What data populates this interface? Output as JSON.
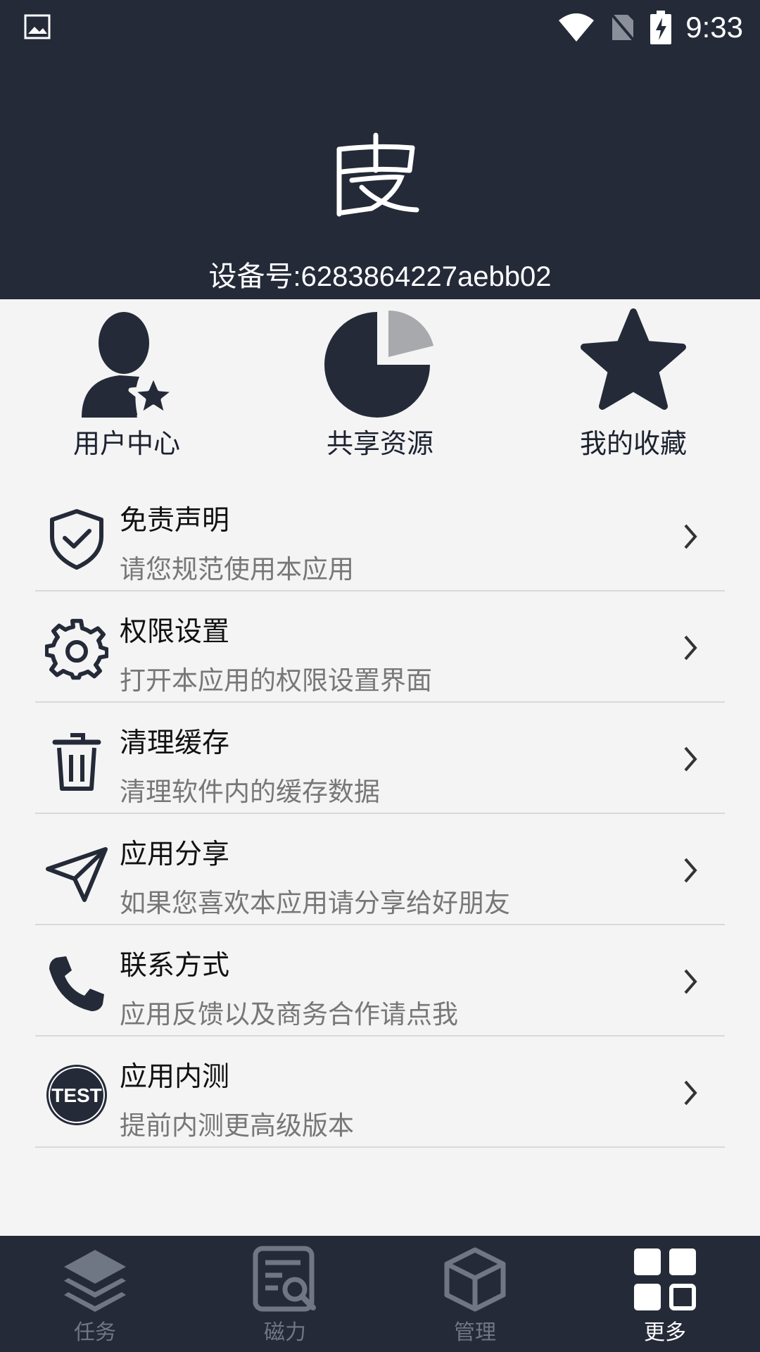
{
  "status_bar": {
    "time": "9:33"
  },
  "header": {
    "logo_text": "皮",
    "device_id": "设备号:6283864227aebb02"
  },
  "quick_actions": [
    {
      "label": "用户中心",
      "icon": "user-star-icon"
    },
    {
      "label": "共享资源",
      "icon": "pie-chart-icon"
    },
    {
      "label": "我的收藏",
      "icon": "star-icon"
    }
  ],
  "menu": [
    {
      "title": "免责声明",
      "subtitle": "请您规范使用本应用",
      "icon": "shield-check-icon"
    },
    {
      "title": "权限设置",
      "subtitle": "打开本应用的权限设置界面",
      "icon": "gear-icon"
    },
    {
      "title": "清理缓存",
      "subtitle": "清理软件内的缓存数据",
      "icon": "trash-icon"
    },
    {
      "title": "应用分享",
      "subtitle": "如果您喜欢本应用请分享给好朋友",
      "icon": "paper-plane-icon"
    },
    {
      "title": "联系方式",
      "subtitle": "应用反馈以及商务合作请点我",
      "icon": "phone-icon"
    },
    {
      "title": "应用内测",
      "subtitle": "提前内测更高级版本",
      "icon": "test-badge-icon",
      "badge_text": "TEST"
    }
  ],
  "bottom_nav": [
    {
      "label": "任务",
      "icon": "layers-icon",
      "active": false
    },
    {
      "label": "磁力",
      "icon": "magnet-search-icon",
      "active": false
    },
    {
      "label": "管理",
      "icon": "box-icon",
      "active": false
    },
    {
      "label": "更多",
      "icon": "grid-icon",
      "active": true
    }
  ],
  "colors": {
    "header_bg": "#242a38",
    "icon_dark": "#242a38",
    "background": "#f4f4f4",
    "nav_inactive": "#6f7684"
  }
}
